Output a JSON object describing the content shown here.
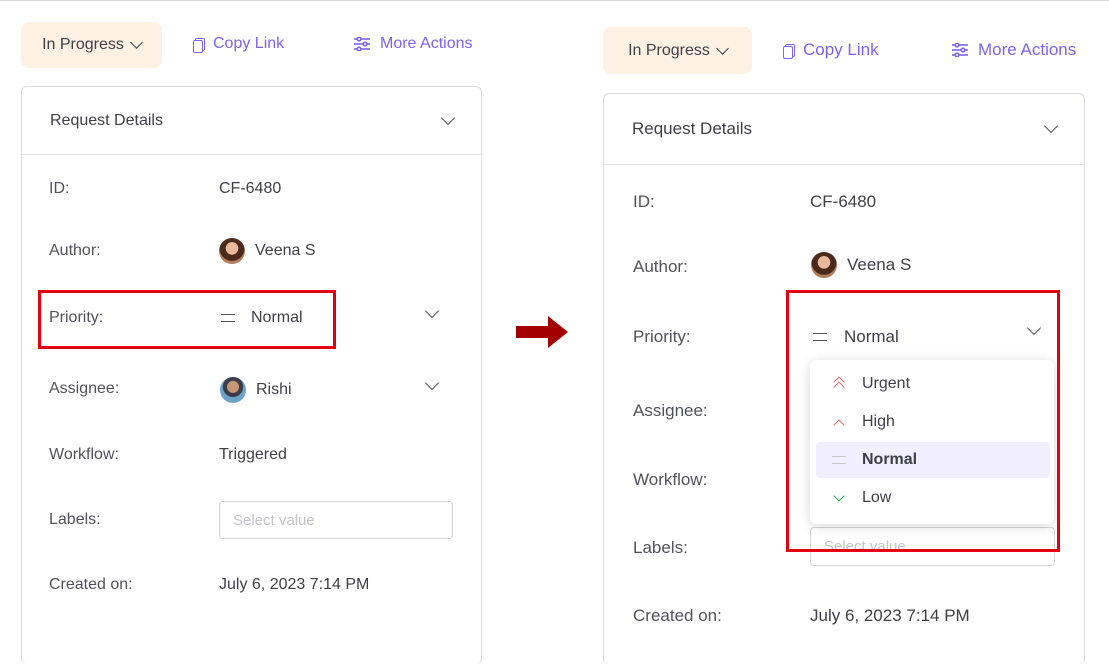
{
  "toolbar": {
    "status_label": "In Progress",
    "copy_link_label": "Copy Link",
    "more_actions_label": "More Actions"
  },
  "card": {
    "title": "Request Details",
    "fields": {
      "id_label": "ID:",
      "id_value": "CF-6480",
      "author_label": "Author:",
      "author_value": "Veena S",
      "priority_label": "Priority:",
      "priority_value": "Normal",
      "assignee_label": "Assignee:",
      "assignee_value": "Rishi",
      "workflow_label": "Workflow:",
      "workflow_value": "Triggered",
      "labels_label": "Labels:",
      "labels_placeholder": "Select value",
      "created_label": "Created on:",
      "created_value": "July 6, 2023 7:14 PM"
    }
  },
  "priority_options": [
    {
      "label": "Urgent",
      "icon": "double-chevron-up-icon",
      "color": "#f06666"
    },
    {
      "label": "High",
      "icon": "chevron-up-icon",
      "color": "#f06666"
    },
    {
      "label": "Normal",
      "icon": "equals-icon",
      "color": "#c8c8d0",
      "selected": true
    },
    {
      "label": "Low",
      "icon": "chevron-down-icon",
      "color": "#22b455"
    }
  ],
  "colors": {
    "accent": "#7c63f5",
    "status_bg": "#fdf1e3",
    "highlight": "#e3000f",
    "arrow": "#a40000",
    "selected_bg": "#f1eefe"
  }
}
